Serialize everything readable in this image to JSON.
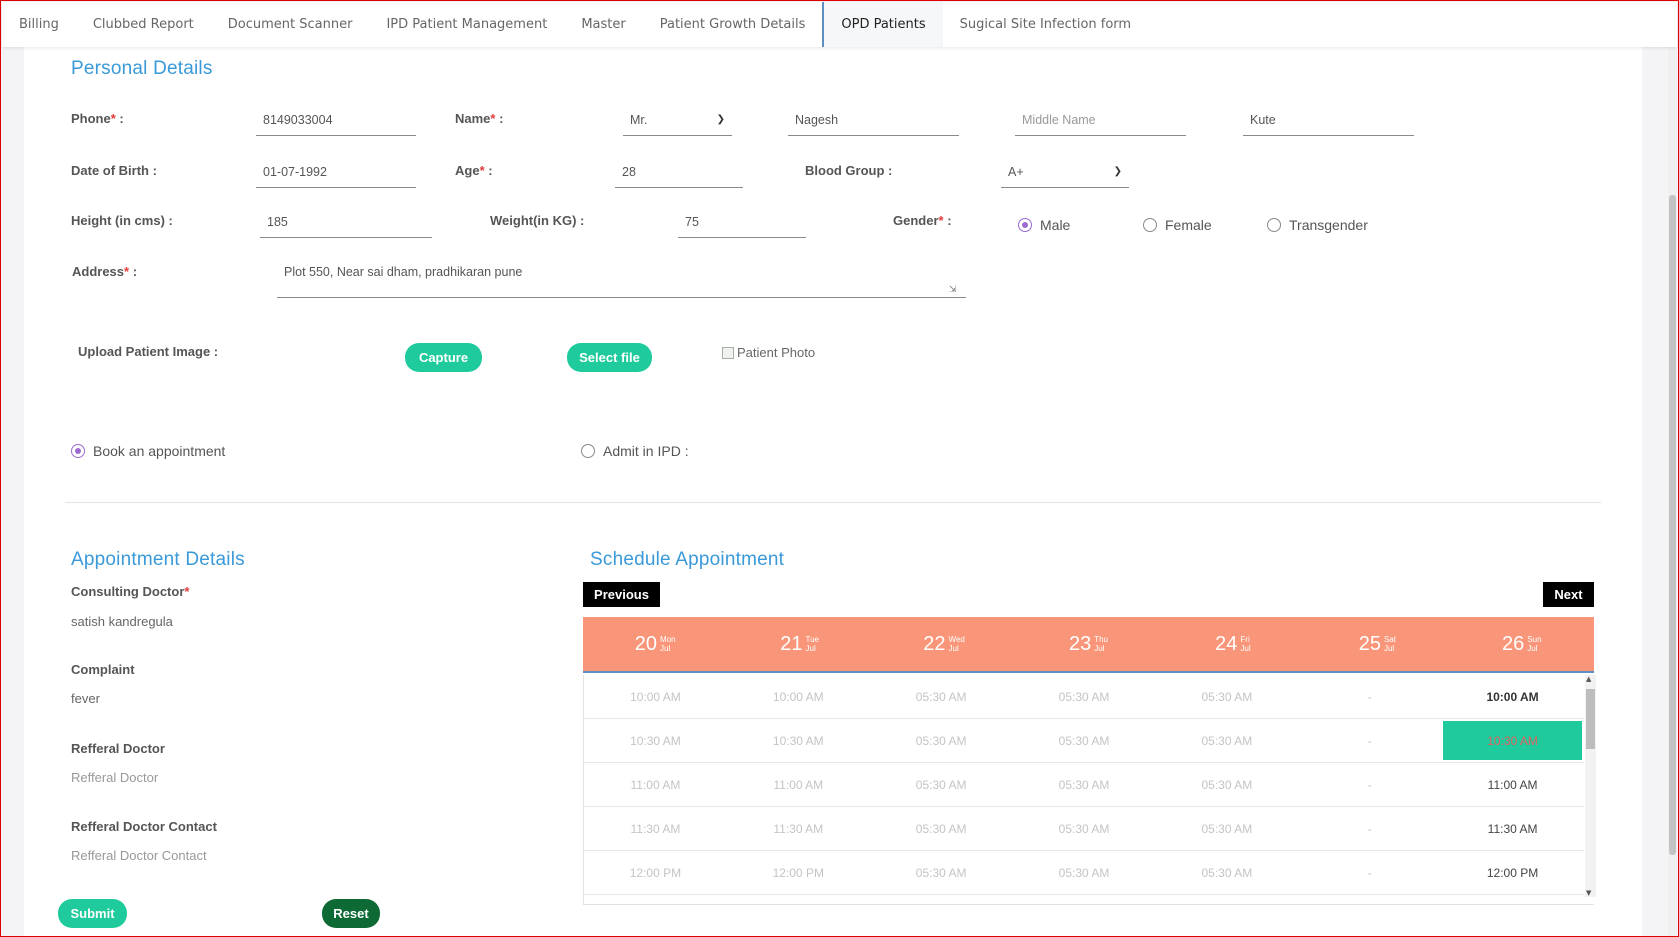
{
  "tabs": [
    "Billing",
    "Clubbed Report",
    "Document Scanner",
    "IPD Patient Management",
    "Master",
    "Patient Growth Details",
    "OPD Patients",
    "Sugical Site Infection form"
  ],
  "active_tab": "OPD Patients",
  "personal": {
    "title": "Personal Details",
    "phone": {
      "label": "Phone",
      "req": "*",
      "suffix": " :",
      "value": "8149033004"
    },
    "name": {
      "label": "Name",
      "req": "*",
      "suffix": " :",
      "salutation": "Mr.",
      "first": "Nagesh",
      "middle_placeholder": "Middle Name",
      "last": "Kute"
    },
    "dob": {
      "label": "Date of Birth :",
      "value": "01-07-1992"
    },
    "age": {
      "label": "Age",
      "req": "*",
      "suffix": " :",
      "value": "28"
    },
    "blood_group": {
      "label": "Blood Group :",
      "value": "A+"
    },
    "height": {
      "label": "Height (in cms) :",
      "value": "185"
    },
    "weight": {
      "label": "Weight(in KG) :",
      "value": "75"
    },
    "gender": {
      "label": "Gender",
      "req": "*",
      "suffix": " :",
      "options": [
        "Male",
        "Female",
        "Transgender"
      ],
      "selected": "Male"
    },
    "address": {
      "label": "Address",
      "req": "*",
      "suffix": " :",
      "value": "Plot 550, Near sai dham, pradhikaran pune"
    },
    "upload": {
      "label": "Upload Patient Image :",
      "capture": "Capture",
      "select": "Select file",
      "photo_alt": "Patient Photo"
    }
  },
  "mode": {
    "book": "Book an appointment",
    "admit": "Admit in IPD :",
    "selected": "book"
  },
  "appointment": {
    "title": "Appointment Details",
    "doctor_label": "Consulting Doctor",
    "doctor_req": "*",
    "doctor_value": "satish kandregula",
    "complaint_label": "Complaint",
    "complaint_value": "fever",
    "ref_doctor_label": "Refferal Doctor",
    "ref_doctor_placeholder": "Refferal Doctor",
    "ref_contact_label": "Refferal Doctor Contact",
    "ref_contact_placeholder": "Refferal Doctor Contact",
    "submit": "Submit",
    "reset": "Reset"
  },
  "schedule": {
    "title": "Schedule Appointment",
    "prev": "Previous",
    "next": "Next",
    "days": [
      {
        "num": "20",
        "dow": "Mon",
        "mon": "Jul"
      },
      {
        "num": "21",
        "dow": "Tue",
        "mon": "Jul"
      },
      {
        "num": "22",
        "dow": "Wed",
        "mon": "Jul"
      },
      {
        "num": "23",
        "dow": "Thu",
        "mon": "Jul"
      },
      {
        "num": "24",
        "dow": "Fri",
        "mon": "Jul"
      },
      {
        "num": "25",
        "dow": "Sat",
        "mon": "Jul"
      },
      {
        "num": "26",
        "dow": "Sun",
        "mon": "Jul"
      }
    ],
    "rows": [
      [
        "10:00 AM",
        "10:00 AM",
        "05:30 AM",
        "05:30 AM",
        "05:30 AM",
        "-",
        "10:00 AM"
      ],
      [
        "10:30 AM",
        "10:30 AM",
        "05:30 AM",
        "05:30 AM",
        "05:30 AM",
        "-",
        "10:30 AM"
      ],
      [
        "11:00 AM",
        "11:00 AM",
        "05:30 AM",
        "05:30 AM",
        "05:30 AM",
        "-",
        "11:00 AM"
      ],
      [
        "11:30 AM",
        "11:30 AM",
        "05:30 AM",
        "05:30 AM",
        "05:30 AM",
        "-",
        "11:30 AM"
      ],
      [
        "12:00 PM",
        "12:00 PM",
        "05:30 AM",
        "05:30 AM",
        "05:30 AM",
        "-",
        "12:00 PM"
      ]
    ],
    "bold_slot": "10:00 AM",
    "selected_slot": "10:30 AM",
    "selected_day": "26"
  },
  "colors": {
    "accent_title": "#3a9ad9",
    "button_green": "#1fcb9c",
    "button_dark": "#0e6a35",
    "calendar_header": "#f9967a",
    "required": "#e23b3b",
    "radio_selected": "#9b6bd0"
  }
}
